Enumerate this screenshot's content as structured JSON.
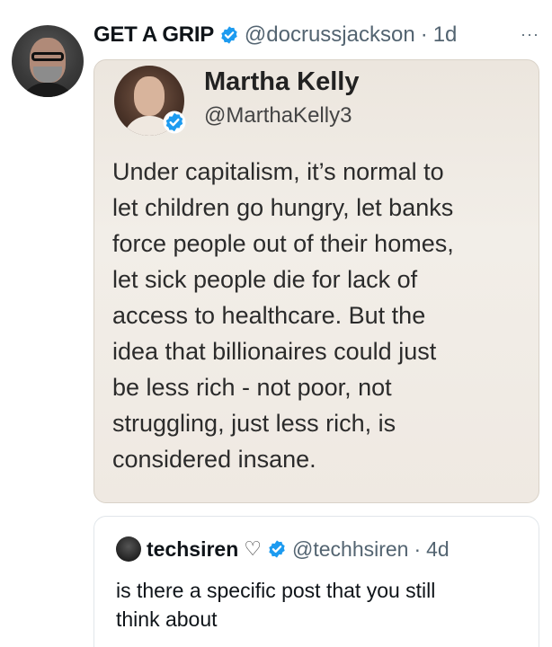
{
  "tweet": {
    "author": {
      "display_name": "GET A GRIP",
      "verified_icon": "verified-badge-icon",
      "handle": "@docrussjackson",
      "separator": "·",
      "time": "1d"
    },
    "more_icon": "more-options-icon",
    "more_label": "···",
    "embedded_image": {
      "name": "Martha Kelly",
      "handle": "@MarthaKelly3",
      "verified_icon": "verified-badge-icon",
      "text": "Under capitalism, it’s normal to\nlet children go hungry, let banks\nforce people out of their homes,\nlet sick people die for lack of\naccess to healthcare. But the\nidea that billionaires could just\nbe less rich - not poor, not\nstruggling, just less rich, is\nconsidered insane."
    },
    "quoted": {
      "display_name": "techsiren",
      "heart_icon": "heart-outline-icon",
      "heart_glyph": "♡",
      "verified_icon": "verified-badge-icon",
      "handle": "@techhsiren",
      "separator": "·",
      "time": "4d",
      "text": "is there a specific post that you still\nthink about"
    }
  },
  "colors": {
    "text_primary": "#0f1419",
    "text_secondary": "#536471",
    "verified_blue": "#1d9bf0",
    "card_background": "#efe9e2"
  }
}
